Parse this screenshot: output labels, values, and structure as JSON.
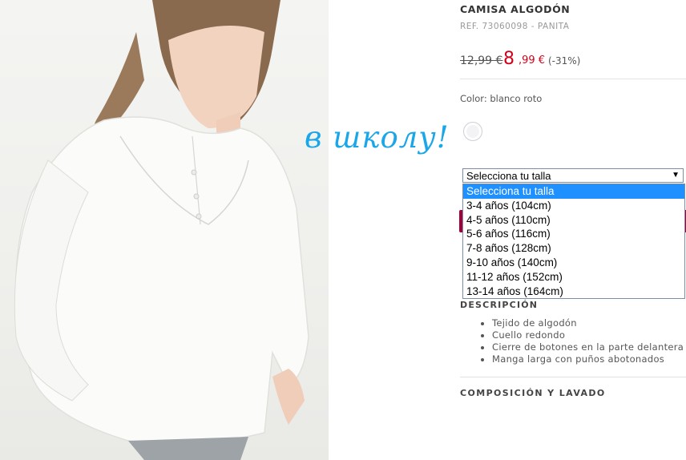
{
  "overlay_text": "в школу!",
  "product": {
    "title": "CAMISA ALGODÓN",
    "ref": "REF. 73060098 - PANITA",
    "price_old": "12,99 €",
    "price_new_int": "8",
    "price_new_dec": ",99 €",
    "discount": "(-31%)",
    "color_label": "Color: blanco roto"
  },
  "size_select": {
    "current": "Selecciona tu talla",
    "options": [
      "Selecciona tu talla",
      "3-4 años (104cm)",
      "4-5 años (110cm)",
      "5-6 años (116cm)",
      "7-8 años (128cm)",
      "9-10 años (140cm)",
      "11-12 años (152cm)",
      "13-14 años (164cm)"
    ]
  },
  "description": {
    "title": "DESCRIPCIÓN",
    "items": [
      "Tejido de algodón",
      "Cuello redondo",
      "Cierre de botones en la parte delantera",
      "Manga larga con puños abotonados"
    ]
  },
  "composition": {
    "title": "COMPOSICIÓN Y LAVADO"
  },
  "colors": {
    "price_red": "#d0021b",
    "overlay_blue": "#1aa6e8",
    "select_highlight": "#1e90ff"
  }
}
